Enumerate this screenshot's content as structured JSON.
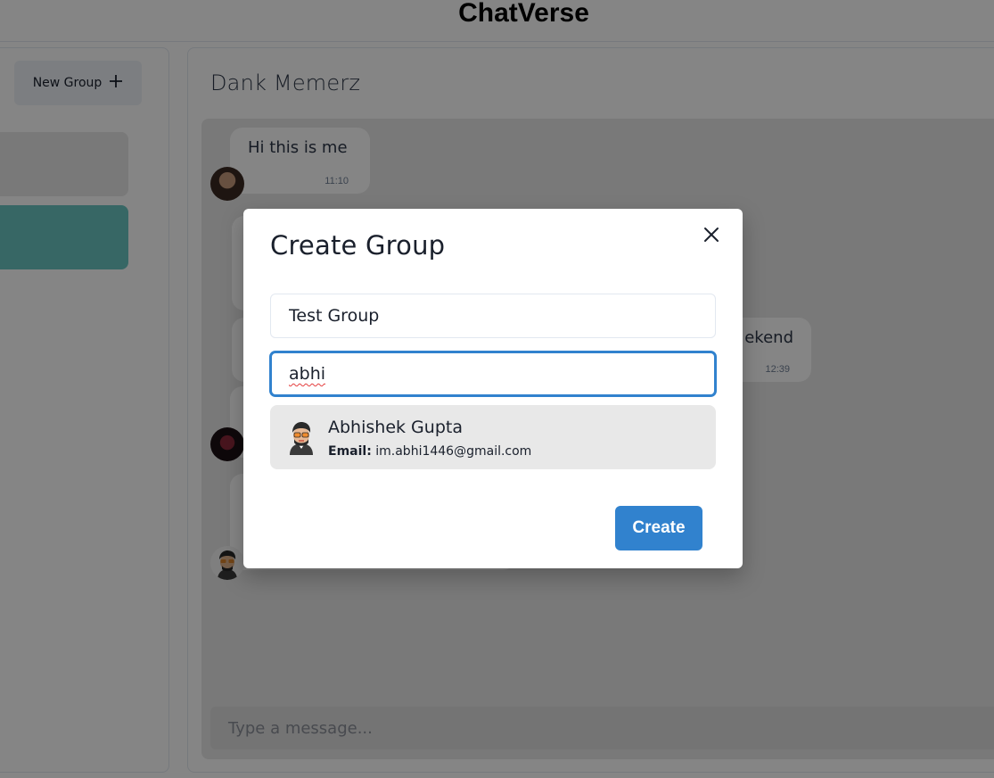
{
  "app": {
    "title": "ChatVerse"
  },
  "sidebar": {
    "new_group_label": "New Group"
  },
  "chat": {
    "name": "Dank Memerz",
    "messages": [
      {
        "text": "Hi this is me",
        "time": "11:10"
      },
      {
        "text": "ekend",
        "time": "12:39"
      }
    ],
    "input_placeholder": "Type a message..."
  },
  "modal": {
    "title": "Create Group",
    "group_name_value": "Test Group",
    "search_value": "abhi",
    "results": [
      {
        "name": "Abhishek Gupta",
        "email_label": "Email:",
        "email": "im.abhi1446@gmail.com"
      }
    ],
    "create_label": "Create"
  },
  "colors": {
    "primary": "#3182ce",
    "selected_chat": "#38b2ac",
    "overlay": "rgba(0,0,0,0.48)"
  }
}
